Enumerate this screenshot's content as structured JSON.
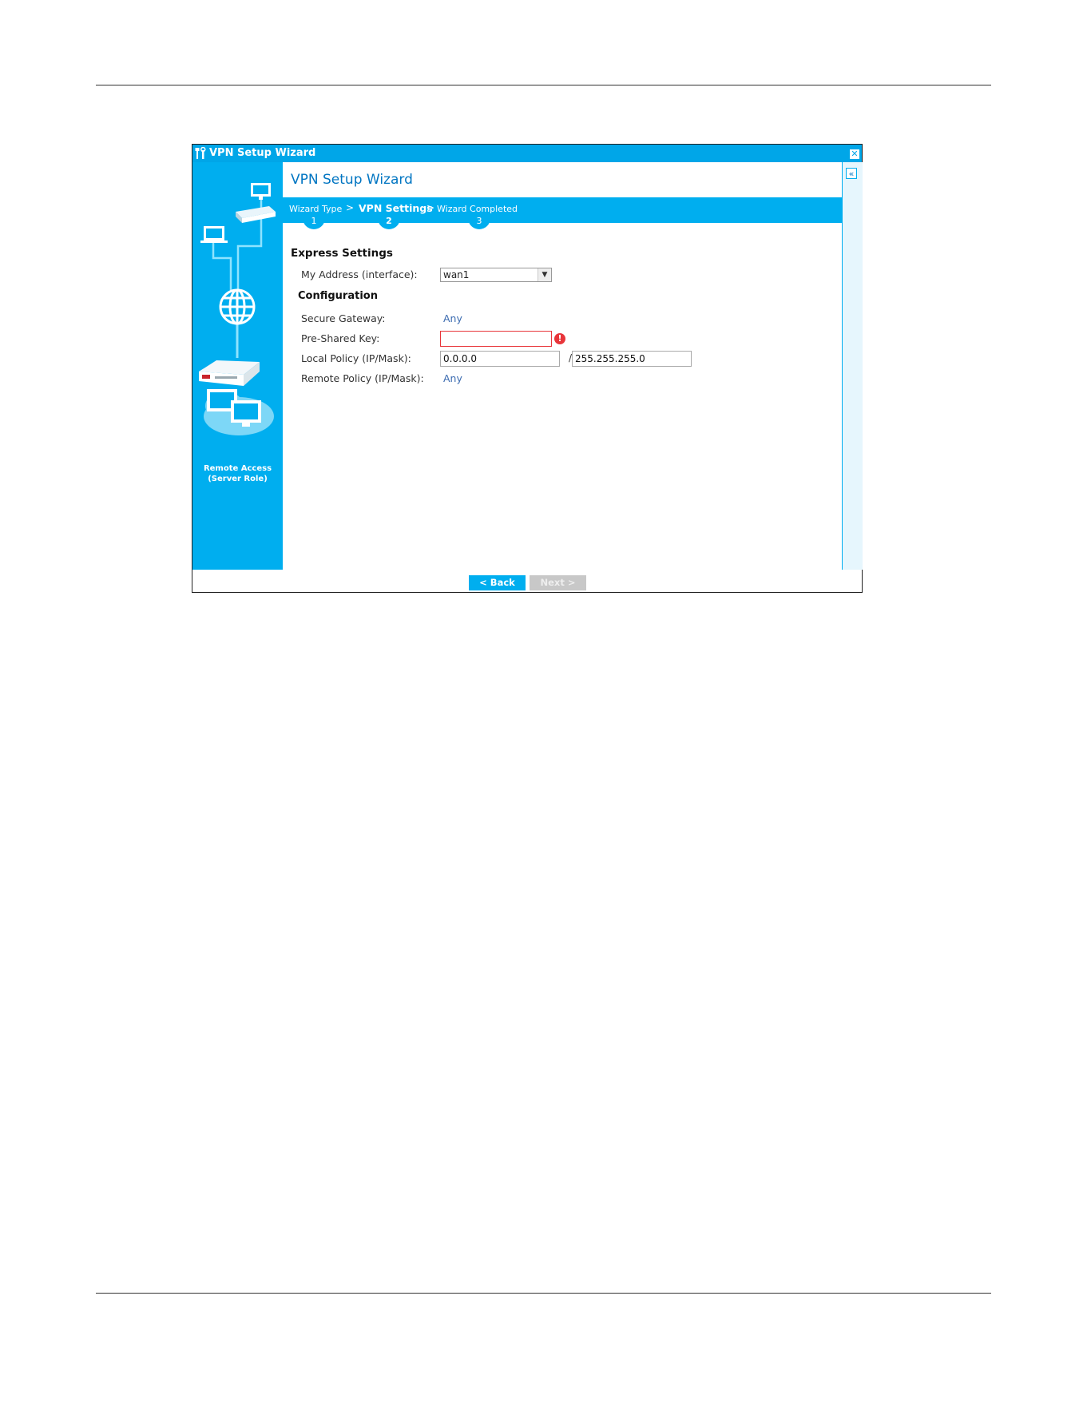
{
  "window": {
    "title": "VPN Setup Wizard",
    "close_glyph": "✕"
  },
  "sidebar": {
    "role_label_line1": "Remote Access",
    "role_label_line2": "(Server Role)"
  },
  "main": {
    "wizard_title": "VPN Setup Wizard",
    "steps": [
      {
        "label": "Wizard Type",
        "number": "1",
        "active": false
      },
      {
        "label": "VPN Settings",
        "number": "2",
        "active": true
      },
      {
        "label": "Wizard Completed",
        "number": "3",
        "active": false
      }
    ],
    "step_separator": ">",
    "express_settings": {
      "heading": "Express Settings",
      "my_address_label": "My Address (interface):",
      "my_address_value": "wan1"
    },
    "configuration": {
      "heading": "Configuration",
      "secure_gateway_label": "Secure Gateway:",
      "secure_gateway_value": "Any",
      "pre_shared_key_label": "Pre-Shared Key:",
      "pre_shared_key_value": "",
      "local_policy_label": "Local Policy (IP/Mask):",
      "local_policy_ip": "0.0.0.0",
      "local_policy_mask": "255.255.255.0",
      "remote_policy_label": "Remote Policy (IP/Mask):",
      "remote_policy_value": "Any"
    }
  },
  "footer": {
    "back_label": "< Back",
    "next_label": "Next >"
  },
  "colors": {
    "accent": "#00aeef",
    "title_blue": "#0075c2",
    "error_red": "#e8353a"
  }
}
